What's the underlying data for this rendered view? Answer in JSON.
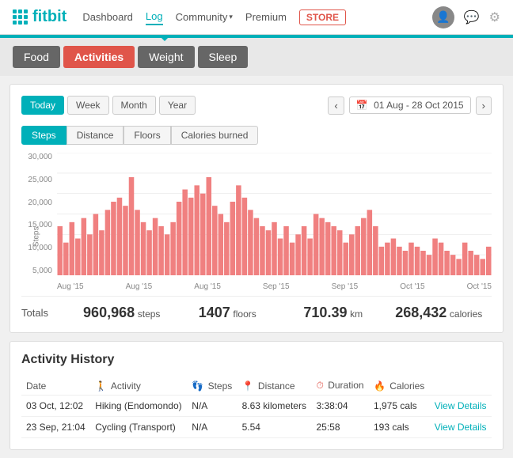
{
  "header": {
    "logo_text": "fitbit",
    "nav": [
      {
        "label": "Dashboard",
        "active": false
      },
      {
        "label": "Log",
        "active": true
      },
      {
        "label": "Community",
        "active": false,
        "has_dropdown": true
      },
      {
        "label": "Premium",
        "active": false
      },
      {
        "label": "STORE",
        "active": false,
        "is_store": true
      }
    ]
  },
  "tabs": [
    {
      "label": "Food",
      "active": false
    },
    {
      "label": "Activities",
      "active": true
    },
    {
      "label": "Weight",
      "active": false
    },
    {
      "label": "Sleep",
      "active": false
    }
  ],
  "period": {
    "buttons": [
      "Today",
      "Week",
      "Month",
      "Year"
    ],
    "active": "Today",
    "date_range": "01 Aug - 28 Oct 2015"
  },
  "metrics": [
    "Steps",
    "Distance",
    "Floors",
    "Calories burned"
  ],
  "active_metric": "Steps",
  "chart": {
    "y_labels": [
      "30,000",
      "25,000",
      "20,000",
      "15,000",
      "10,000",
      "5,000",
      ""
    ],
    "x_labels": [
      "Aug '15",
      "Aug '15",
      "Aug '15",
      "Sep '15",
      "Sep '15",
      "Oct '15",
      "Oct '15"
    ],
    "y_axis_title": "Steps",
    "bars": [
      12000,
      8000,
      13000,
      9000,
      14000,
      10000,
      15000,
      11000,
      16000,
      18000,
      19000,
      17000,
      24000,
      16000,
      13000,
      11000,
      14000,
      12000,
      10000,
      13000,
      18000,
      21000,
      19000,
      22000,
      20000,
      24000,
      17000,
      15000,
      13000,
      18000,
      22000,
      19000,
      16000,
      14000,
      12000,
      11000,
      13000,
      9000,
      12000,
      8000,
      10000,
      12000,
      9000,
      15000,
      14000,
      13000,
      12000,
      11000,
      8000,
      10000,
      12000,
      14000,
      16000,
      12000,
      7000,
      8000,
      9000,
      7000,
      6000,
      8000,
      7000,
      6000,
      5000,
      9000,
      8000,
      6000,
      5000,
      4000,
      8000,
      6000,
      5000,
      4000,
      7000
    ]
  },
  "totals": {
    "label": "Totals",
    "steps": {
      "value": "960,968",
      "unit": "steps"
    },
    "floors": {
      "value": "1407",
      "unit": "floors"
    },
    "distance": {
      "value": "710.39",
      "unit": "km"
    },
    "calories": {
      "value": "268,432",
      "unit": "calories"
    }
  },
  "activity_history": {
    "title": "Activity History",
    "columns": [
      "Date",
      "Activity",
      "Steps",
      "Distance",
      "Duration",
      "Calories",
      ""
    ],
    "rows": [
      {
        "date": "03 Oct, 12:02",
        "activity": "Hiking (Endomondo)",
        "steps": "N/A",
        "distance": "8.63 kilometers",
        "duration": "3:38:04",
        "calories": "1,975 cals",
        "link": "View Details"
      },
      {
        "date": "23 Sep, 21:04",
        "activity": "Cycling (Transport)",
        "steps": "N/A",
        "distance": "5.54",
        "duration": "25:58",
        "calories": "193 cals",
        "link": "View Details"
      }
    ]
  }
}
